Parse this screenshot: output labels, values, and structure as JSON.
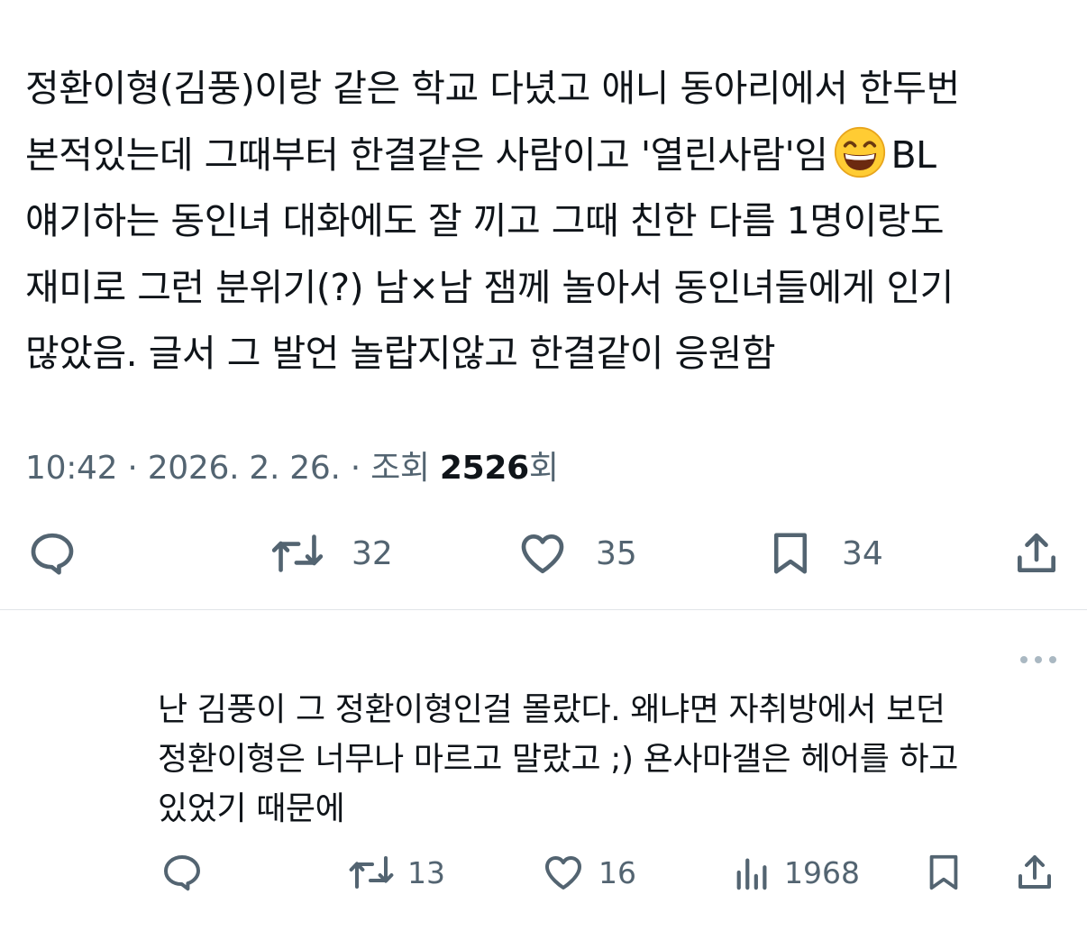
{
  "tweet": {
    "lines": [
      "정환이형(김풍)이랑 같은 학교 다녔고 애니 동아리에서 한두번",
      "본적있는데 그때부터 한결같은 사람이고 '열린사람'임",
      "BL",
      "얘기하는 동인녀 대화에도 잘 끼고 그때 친한 다름 1명이랑도",
      "재미로 그런 분위기(?) 남×남 잼께 놀아서 동인녀들에게 인기",
      "많았음. 글서 그 발언 놀랍지않고 한결같이 응원함"
    ],
    "emoji": "grinning-face-emoji",
    "meta": {
      "time": "10:42",
      "sep1": " · ",
      "date": "2026. 2. 26.",
      "sep2": " · ",
      "views_label": "조회 ",
      "views_count": "2526",
      "views_suffix": "회"
    },
    "actions": {
      "reply_icon": "reply-icon",
      "retweet_count": "32",
      "like_count": "35",
      "bookmark_count": "34",
      "share_icon": "share-icon"
    }
  },
  "reply": {
    "lines": [
      "난 김풍이 그 정환이형인걸 몰랐다. 왜냐면 자취방에서 보던",
      "정환이형은 너무나 마르고 말랐고 ;) 욘사마갤은 헤어를 하고",
      "있었기 때문에"
    ],
    "actions": {
      "retweet_count": "13",
      "like_count": "16",
      "views_count": "1968"
    }
  },
  "colors": {
    "text": "#0f1419",
    "secondary": "#536471",
    "divider": "#e1e5e8"
  }
}
